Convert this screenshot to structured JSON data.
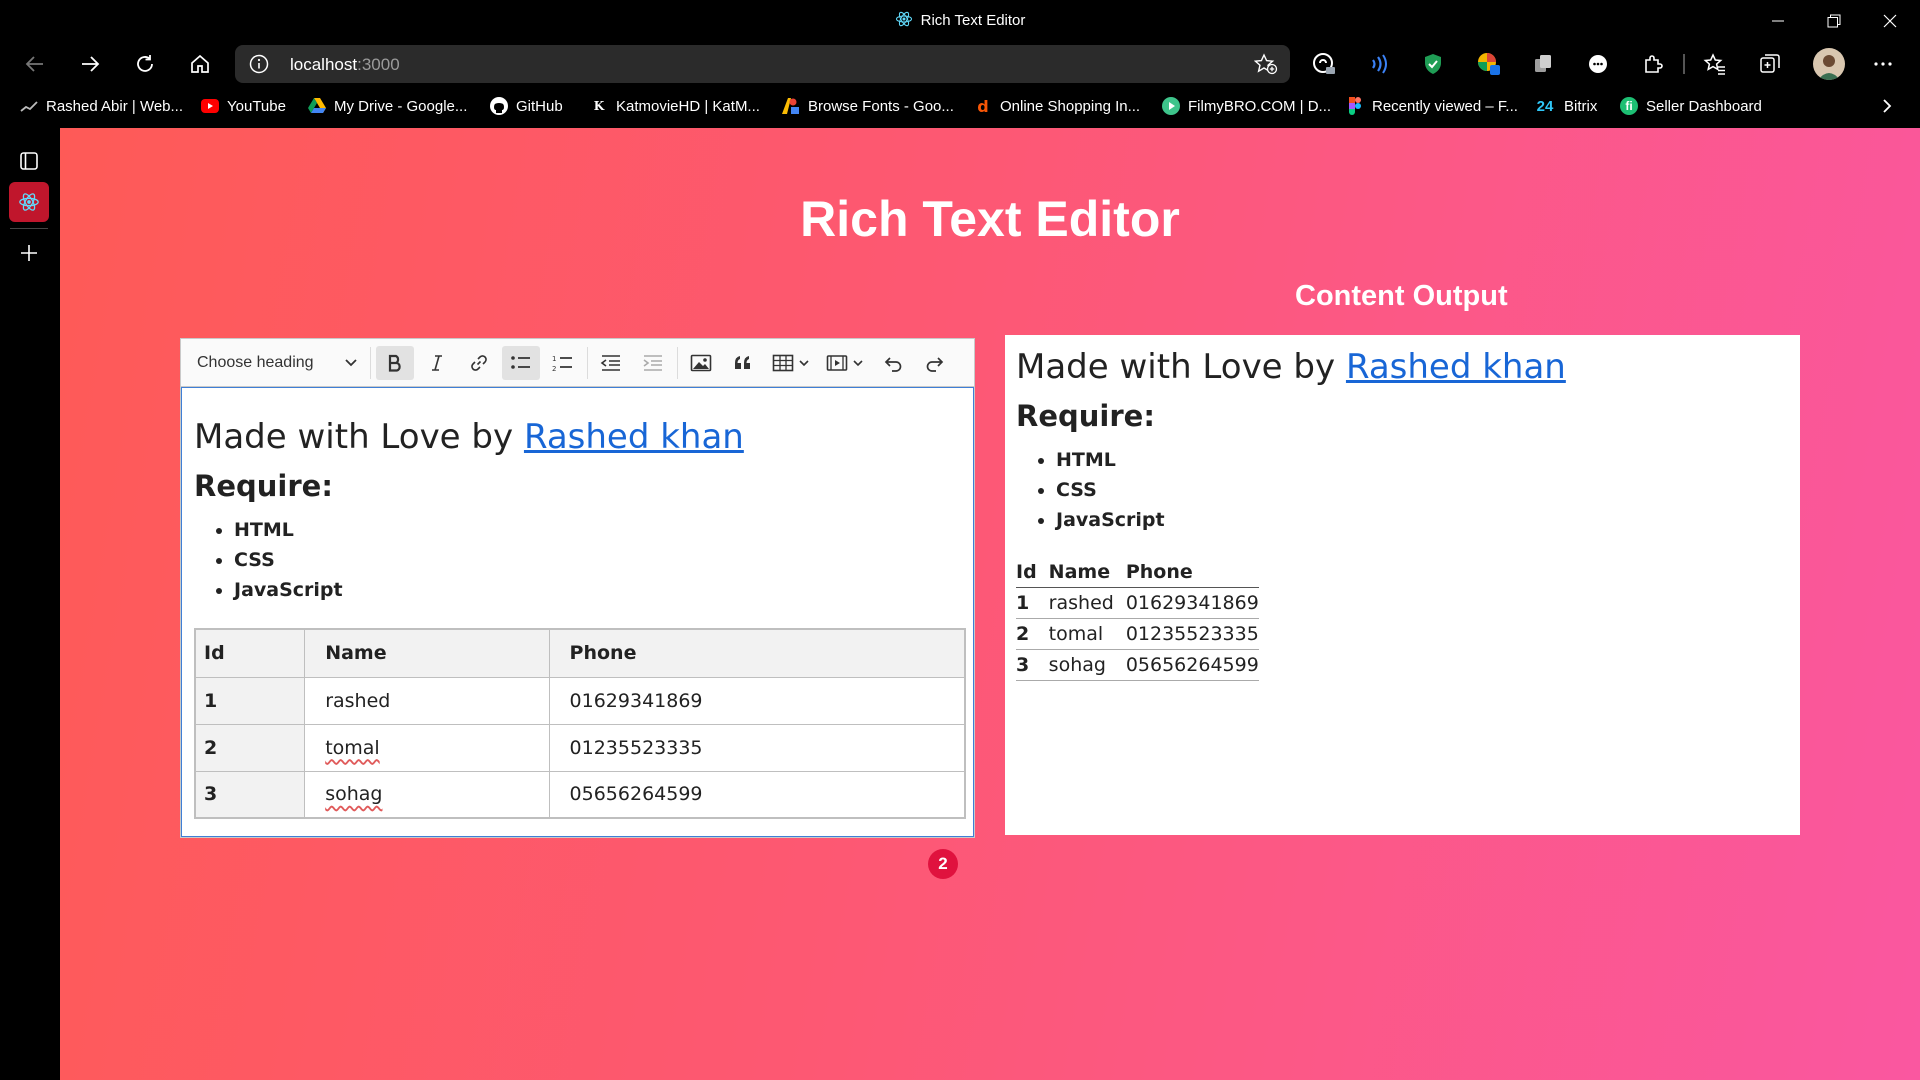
{
  "window": {
    "title": "Rich Text Editor"
  },
  "address_bar": {
    "url_host": "localhost",
    "url_port": ":3000"
  },
  "bookmarks": [
    {
      "label": "Rashed Abir | Web...",
      "icon": "chart-icon"
    },
    {
      "label": "YouTube",
      "icon": "youtube-icon"
    },
    {
      "label": "My Drive - Google...",
      "icon": "google-drive-icon"
    },
    {
      "label": "GitHub",
      "icon": "github-icon"
    },
    {
      "label": "KatmovieHD | KatM...",
      "icon": "katmovie-icon"
    },
    {
      "label": "Browse Fonts - Goo...",
      "icon": "google-fonts-icon"
    },
    {
      "label": "Online Shopping In...",
      "icon": "daraz-icon"
    },
    {
      "label": "FilmyBRO.COM | D...",
      "icon": "filmybro-icon"
    },
    {
      "label": "Recently viewed – F...",
      "icon": "figma-icon"
    },
    {
      "label": "Bitrix",
      "icon": "bitrix-icon"
    },
    {
      "label": "Seller Dashboard",
      "icon": "fiverr-icon"
    }
  ],
  "page": {
    "title": "Rich Text Editor",
    "output_title": "Content Output"
  },
  "toolbar": {
    "heading_select": "Choose heading",
    "active_buttons": [
      "bold",
      "bulleted-list"
    ]
  },
  "document": {
    "heading_prefix": "Made with Love by ",
    "heading_link": "Rashed khan",
    "subheading": "Require:",
    "list": [
      "HTML",
      "CSS",
      "JavaScript"
    ],
    "table": {
      "headers": [
        "Id",
        "Name",
        "Phone"
      ],
      "rows": [
        [
          "1",
          "rashed",
          "01629341869"
        ],
        [
          "2",
          "tomal",
          "01235523335"
        ],
        [
          "3",
          "sohag",
          "05656264599"
        ]
      ]
    }
  },
  "badge_count": "2",
  "colors": {
    "gradient_start": "#fe5a57",
    "gradient_end": "#fa57a0",
    "link": "#1866d6",
    "badge": "#e0123e",
    "focus_border": "#3f7fd6"
  }
}
